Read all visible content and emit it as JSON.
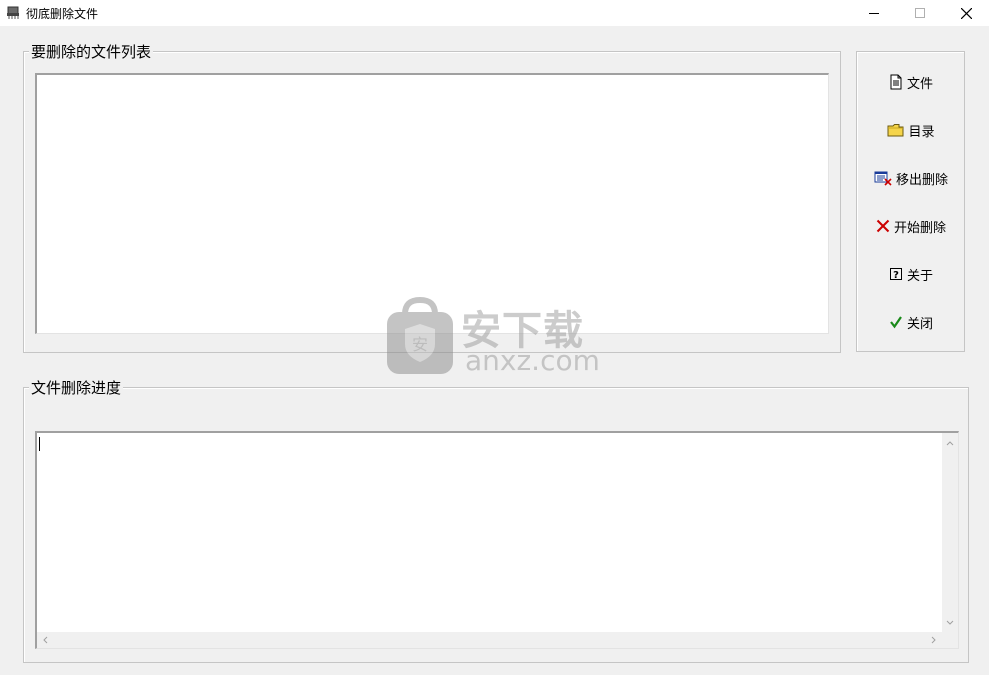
{
  "window": {
    "title": "彻底删除文件",
    "icon": "shredder-app-icon",
    "controls": [
      "minimize-icon",
      "maximize-icon",
      "close-icon"
    ]
  },
  "file_list_group": {
    "label": "要删除的文件列表",
    "items": []
  },
  "progress_group": {
    "label": "文件删除进度",
    "log_text": ""
  },
  "side_buttons": [
    {
      "id": "file",
      "label": "文件",
      "icon": "document-icon"
    },
    {
      "id": "directory",
      "label": "目录",
      "icon": "folder-icon"
    },
    {
      "id": "remove",
      "label": "移出删除",
      "icon": "remove-list-icon"
    },
    {
      "id": "start",
      "label": "开始删除",
      "icon": "red-x-icon"
    },
    {
      "id": "about",
      "label": "关于",
      "icon": "help-icon"
    },
    {
      "id": "close",
      "label": "关闭",
      "icon": "green-check-icon"
    }
  ],
  "watermark": {
    "cn": "安下载",
    "en": "anxz.com"
  },
  "colors": {
    "window_bg": "#f0f0f0",
    "titlebar_bg": "#ffffff",
    "start_icon": "#cc0000",
    "close_icon": "#1a8a1a",
    "folder_icon": "#f5d44a"
  }
}
